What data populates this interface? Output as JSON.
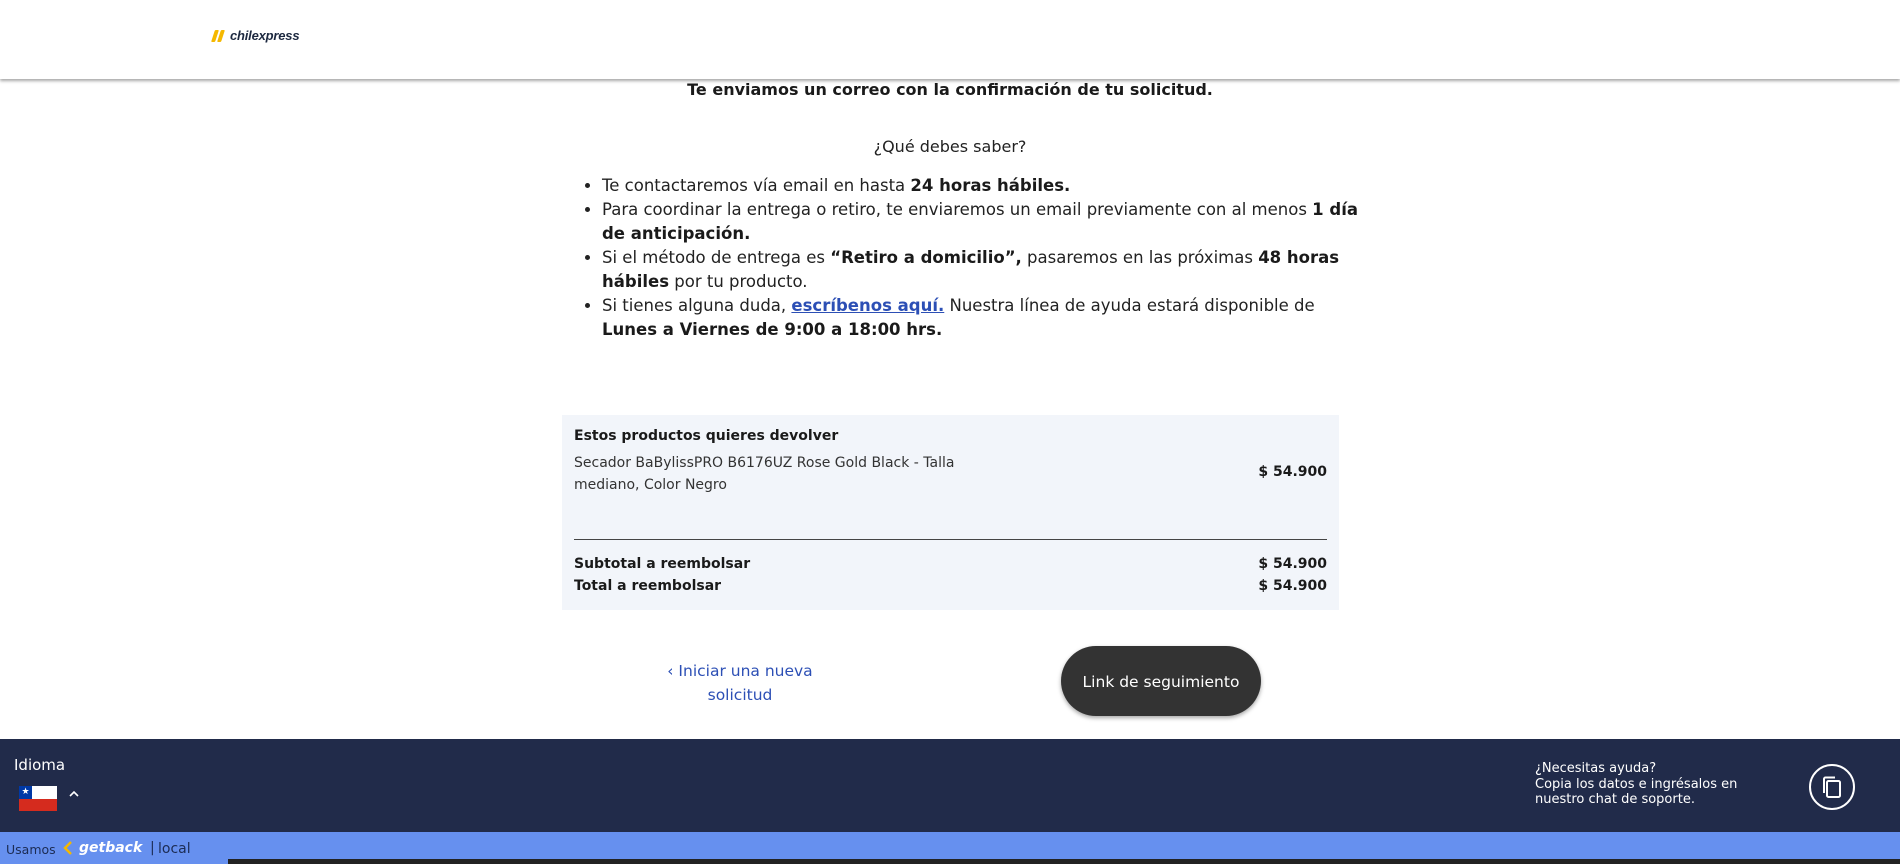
{
  "brand": {
    "name": "chilexpress",
    "accent": "#f5b800"
  },
  "message": {
    "confirmation": "Te enviamos un correo con la confirmación de tu solicitud.",
    "question": "¿Qué debes saber?"
  },
  "bullets": [
    {
      "text1": "Te contactaremos vía email en hasta ",
      "bold1": "24 horas hábiles."
    },
    {
      "text1": "Para coordinar la entrega o retiro, te enviaremos un email previamente con al menos ",
      "bold1": "1 día de anticipación."
    },
    {
      "text1": "Si el método de entrega es ",
      "bold1": "“Retiro a domicilio”,",
      "text2": " pasaremos en las próximas ",
      "bold2": "48 horas hábiles",
      "text3": " por tu producto."
    },
    {
      "text1": "Si tienes alguna duda, ",
      "link": "escríbenos aquí.",
      "text2": " Nuestra línea de ayuda estará disponible de ",
      "bold1": "Lunes a Viernes de 9:00 a 18:00 hrs."
    }
  ],
  "summary": {
    "title": "Estos productos quieres devolver",
    "product": {
      "name": "Secador BaBylissPRO B6176UZ Rose Gold Black - Talla mediano, Color Negro",
      "price": "$ 54.900"
    },
    "subtotal_label": "Subtotal a reembolsar",
    "subtotal_value": "$ 54.900",
    "total_label": "Total a reembolsar",
    "total_value": "$ 54.900"
  },
  "actions": {
    "new_request": "‹ Iniciar una nueva solicitud",
    "tracking": "Link de seguimiento"
  },
  "footer": {
    "language_label": "Idioma",
    "flag_icon": "chile-flag-icon",
    "chevron_icon": "chevron-up-icon",
    "help_title": "¿Necesitas ayuda?",
    "help_body": "Copia los datos e ingrésalos en nuestro chat de soporte.",
    "copy_icon": "copy-icon",
    "background": "#212b4a"
  },
  "powered": {
    "usamos": "Usamos",
    "getback": "getback",
    "separator": "|",
    "local": "local",
    "background": "#6690ef"
  }
}
